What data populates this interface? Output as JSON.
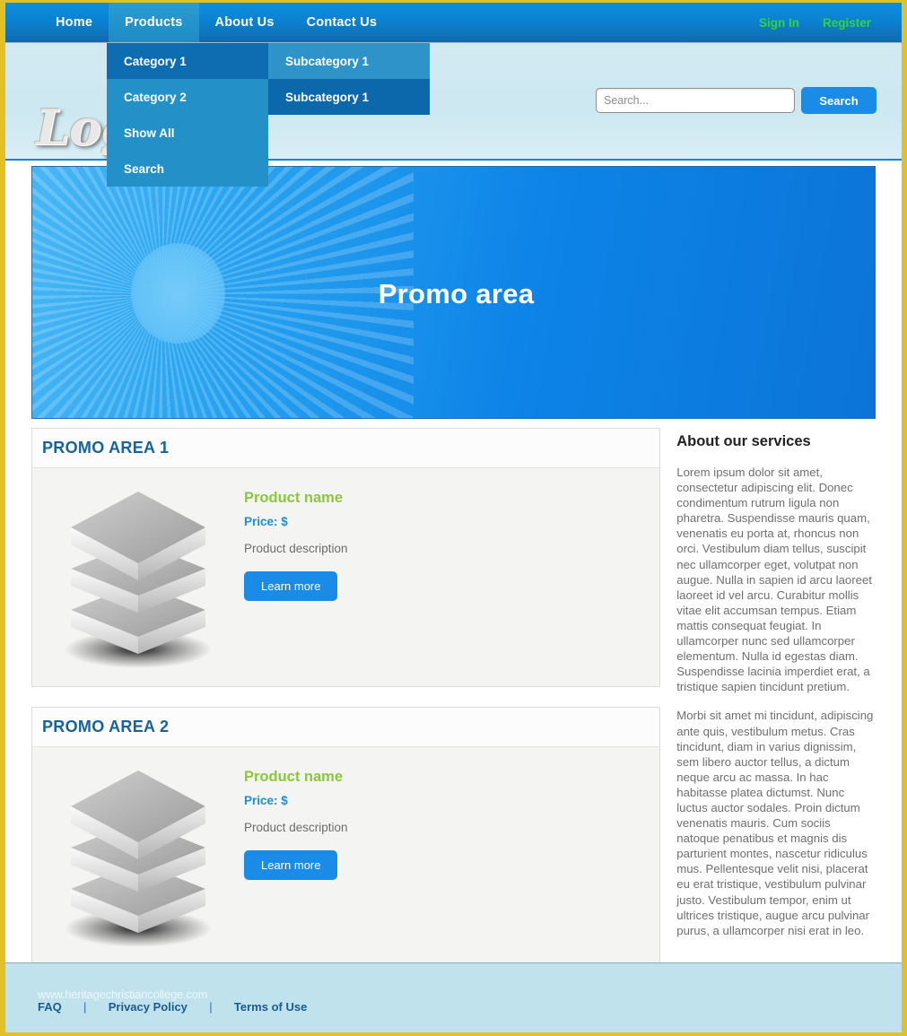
{
  "nav": {
    "items": [
      {
        "label": "Home",
        "active": false
      },
      {
        "label": "Products",
        "active": true
      },
      {
        "label": "About Us",
        "active": false
      },
      {
        "label": "Contact Us",
        "active": false
      }
    ],
    "auth": [
      {
        "label": "Sign In"
      },
      {
        "label": "Register"
      }
    ],
    "accent_color": "#35d43b"
  },
  "dropdown": {
    "items": [
      {
        "label": "Category 1",
        "highlighted": true
      },
      {
        "label": "Category 2",
        "highlighted": false
      },
      {
        "label": "Show All",
        "highlighted": false
      },
      {
        "label": "Search",
        "highlighted": false
      }
    ]
  },
  "subdropdown": {
    "items": [
      {
        "label": "Subcategory 1",
        "highlighted": false
      },
      {
        "label": "Subcategory 1",
        "highlighted": true
      }
    ]
  },
  "header": {
    "logo_text": "Logo",
    "search": {
      "value": "",
      "placeholder": "Search...",
      "button_label": "Search"
    }
  },
  "banner": {
    "title": "Promo area"
  },
  "cards": [
    {
      "heading": "PROMO AREA 1",
      "product": {
        "name": "Product name",
        "price": "Price: $",
        "description": "Product description",
        "button_label": "Learn more"
      }
    },
    {
      "heading": "PROMO AREA 2",
      "product": {
        "name": "Product name",
        "price": "Price: $",
        "description": "Product description",
        "button_label": "Learn more"
      }
    }
  ],
  "sidebar": {
    "title": "About our services",
    "paragraphs": [
      "Lorem ipsum dolor sit amet, consectetur adipiscing elit. Donec condimentum rutrum ligula non pharetra. Suspendisse mauris quam, venenatis eu porta at, rhoncus non orci. Vestibulum diam tellus, suscipit nec ullamcorper eget, volutpat non augue. Nulla in sapien id arcu laoreet laoreet id vel arcu. Curabitur mollis vitae elit accumsan tempus. Etiam mattis consequat feugiat. In ullamcorper nunc sed ullamcorper elementum. Nulla id egestas diam. Suspendisse lacinia imperdiet erat, a tristique sapien tincidunt pretium.",
      "Morbi sit amet mi tincidunt, adipiscing ante quis, vestibulum metus. Cras tincidunt, diam in varius dignissim, sem libero auctor tellus, a dictum neque arcu ac massa. In hac habitasse platea dictumst. Nunc luctus auctor sodales. Proin dictum venenatis mauris. Cum sociis natoque penatibus et magnis dis parturient montes, nascetur ridiculus mus. Pellentesque velit nisi, placerat eu erat tristique, vestibulum pulvinar justo. Vestibulum tempor, enim ut ultrices tristique, augue arcu pulvinar purus, a ullamcorper nisi erat in leo."
    ]
  },
  "footer": {
    "links": [
      {
        "label": "FAQ"
      },
      {
        "label": "Privacy Policy"
      },
      {
        "label": "Terms of Use"
      }
    ],
    "separator": "|",
    "watermark": "www.heritagechristiancollege.com"
  },
  "colors": {
    "page_border": "#e3c126",
    "nav_blue": "#0d84d8",
    "accent_green": "#8cc63e",
    "link_blue": "#1a8ce8",
    "heading_blue": "#15639f"
  }
}
